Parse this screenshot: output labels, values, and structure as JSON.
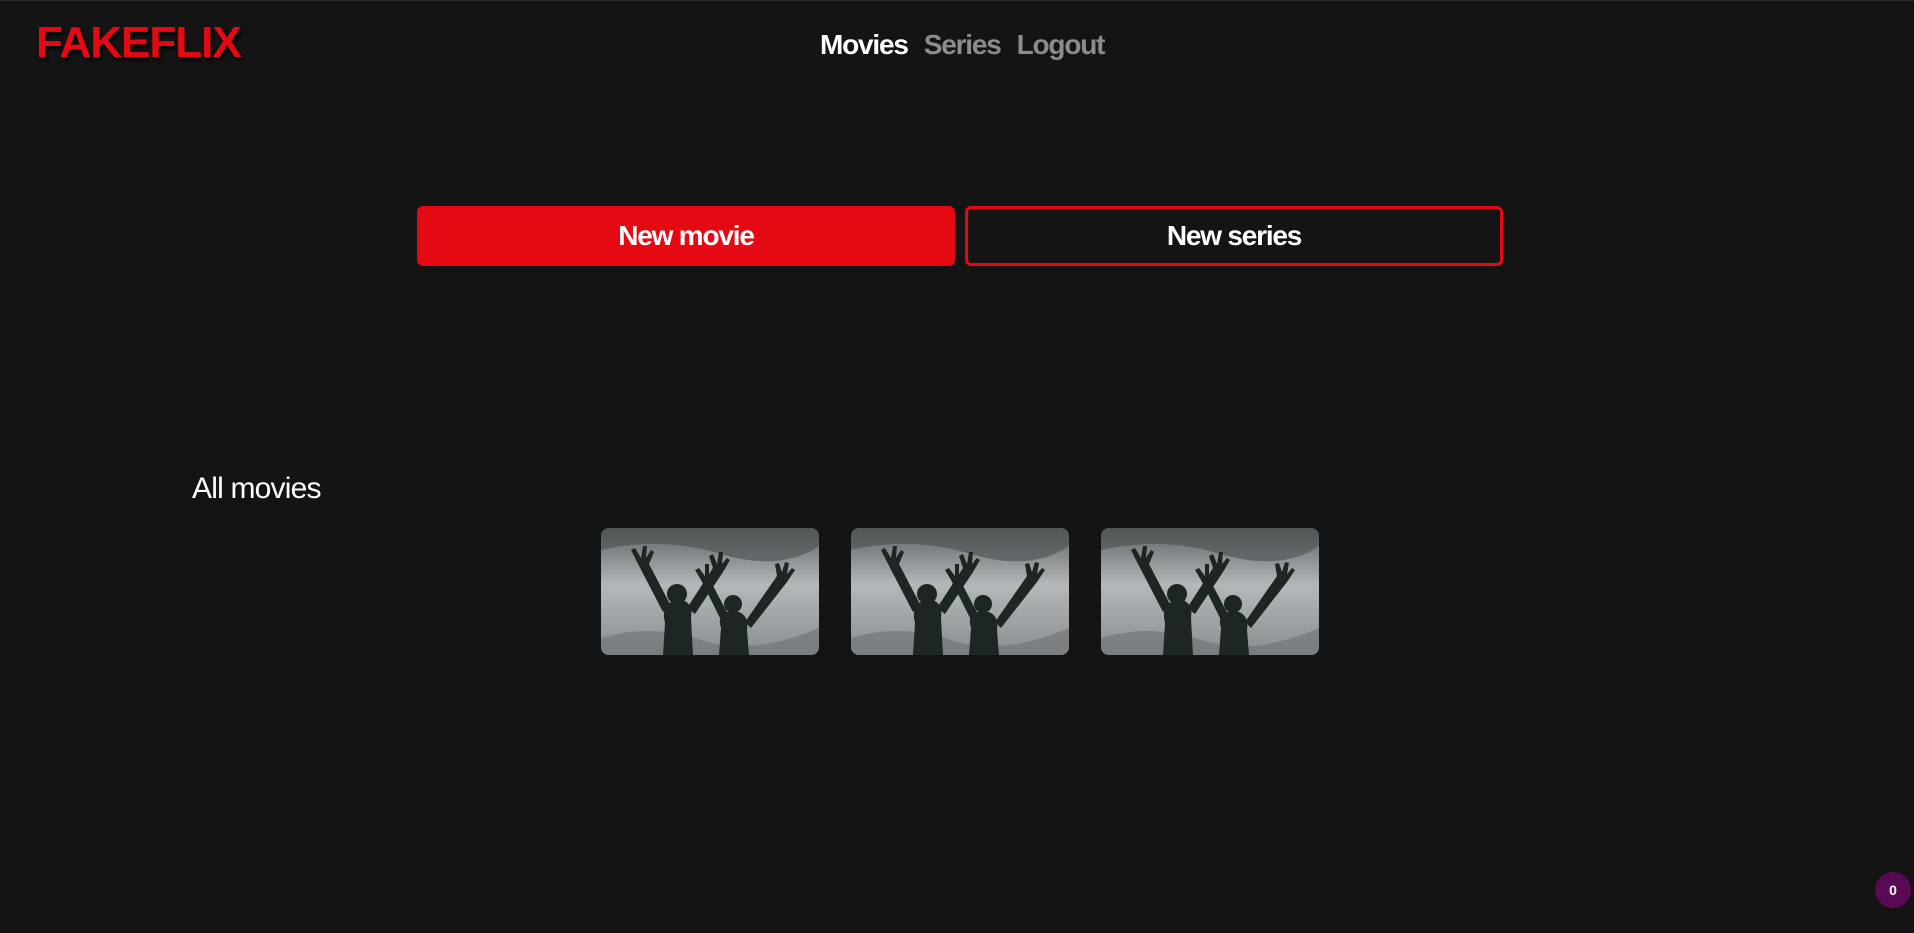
{
  "app": {
    "logo": "FAKEFLIX",
    "brand_color": "#e50914",
    "background_color": "#141414"
  },
  "nav": {
    "items": [
      {
        "label": "Movies",
        "active": true
      },
      {
        "label": "Series",
        "active": false
      },
      {
        "label": "Logout",
        "active": false
      }
    ]
  },
  "actions": {
    "new_movie_label": "New movie",
    "new_series_label": "New series"
  },
  "movies": {
    "section_title": "All movies",
    "items": [
      {
        "thumbnail": "statues-raised-arms-image"
      },
      {
        "thumbnail": "statues-raised-arms-image"
      },
      {
        "thumbnail": "statues-raised-arms-image"
      }
    ]
  },
  "badge": {
    "count": "0",
    "color": "#5a0a55"
  }
}
